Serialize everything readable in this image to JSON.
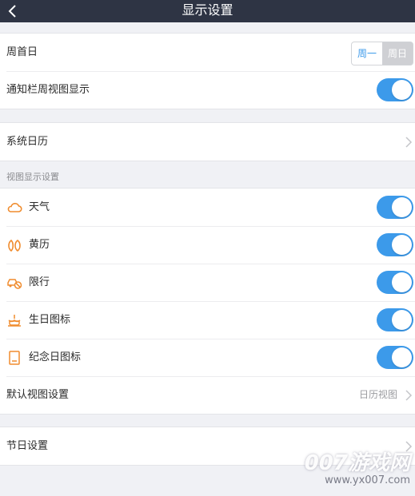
{
  "header": {
    "title": "显示设置"
  },
  "week_start": {
    "label": "周首日",
    "options": [
      "周一",
      "周日"
    ],
    "selected": "周一"
  },
  "notify_week_view": {
    "label": "通知栏周视图显示",
    "on": true
  },
  "system_calendar": {
    "label": "系统日历"
  },
  "view_section": {
    "title": "视图显示设置"
  },
  "view_items": [
    {
      "label": "天气",
      "icon": "cloud-icon",
      "on": true
    },
    {
      "label": "黄历",
      "icon": "almanac-icon",
      "on": true
    },
    {
      "label": "限行",
      "icon": "car-restriction-icon",
      "on": true
    },
    {
      "label": "生日图标",
      "icon": "birthday-cake-icon",
      "on": true
    },
    {
      "label": "纪念日图标",
      "icon": "anniversary-icon",
      "on": true
    }
  ],
  "default_view": {
    "label": "默认视图设置",
    "value": "日历视图"
  },
  "holiday": {
    "label": "节日设置"
  },
  "watermark": {
    "line1": "007游戏网",
    "line2": "www.yx007.com"
  },
  "colors": {
    "accent": "#3c9aea",
    "icon_orange": "#f08c2e",
    "header": "#2e3444"
  }
}
